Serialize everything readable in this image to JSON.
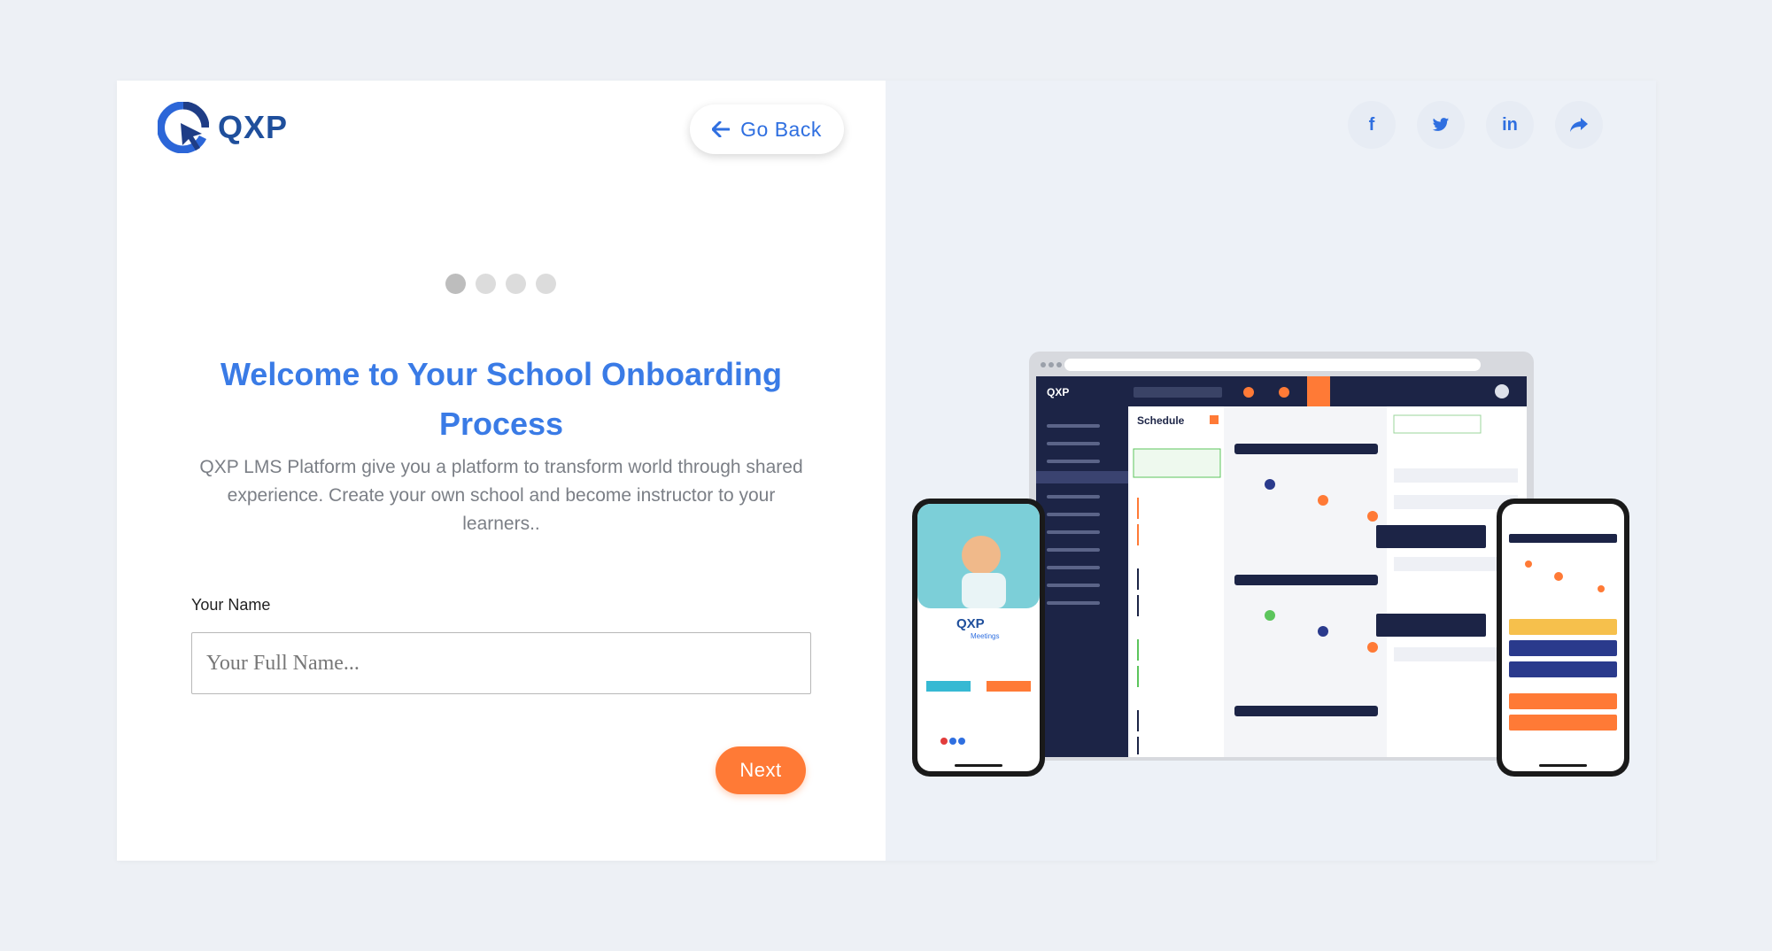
{
  "brand": {
    "name": "QXP"
  },
  "nav": {
    "go_back_label": "Go Back"
  },
  "steps": {
    "total": 4,
    "current": 1
  },
  "welcome": {
    "title": "Welcome to Your School Onboarding Process",
    "description": "QXP LMS Platform give you a platform to transform world through shared experience. Create your own school and become instructor to your learners.."
  },
  "form": {
    "name_label": "Your Name",
    "name_placeholder": "Your Full Name...",
    "name_value": "",
    "next_label": "Next"
  },
  "social": [
    {
      "icon": "facebook-icon",
      "glyph": "f"
    },
    {
      "icon": "twitter-icon",
      "glyph": ""
    },
    {
      "icon": "linkedin-icon",
      "glyph": "in"
    },
    {
      "icon": "share-icon",
      "glyph": ""
    }
  ],
  "illustration": {
    "desktop_app_name": "QXP",
    "schedule_title": "Schedule",
    "mobile_app_name": "QXP",
    "mobile_app_sub": "Meetings"
  },
  "colors": {
    "accent_blue": "#3a7be6",
    "accent_orange": "#ff7a36",
    "brand_navy": "#1f4f9c",
    "dark_sidebar": "#1c2446"
  }
}
